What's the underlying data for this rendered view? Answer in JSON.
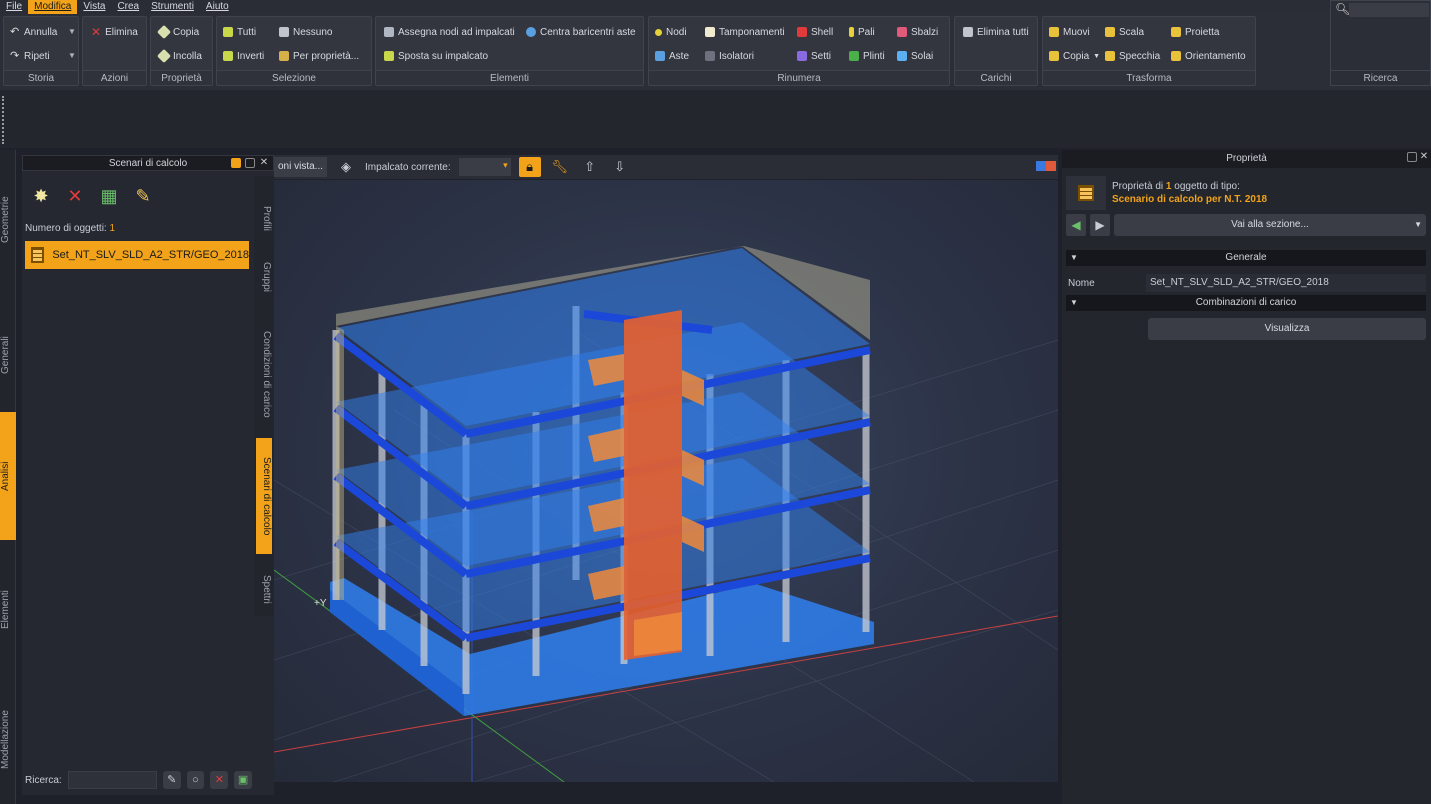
{
  "menu": [
    "File",
    "Modifica",
    "Vista",
    "Crea",
    "Strumenti",
    "Aiuto"
  ],
  "ribbon": {
    "storia": {
      "label": "Storia",
      "undo": "Annulla",
      "redo": "Ripeti"
    },
    "azioni": {
      "label": "Azioni",
      "elimina": "Elimina"
    },
    "proprieta": {
      "label": "Proprietà",
      "copia": "Copia",
      "incolla": "Incolla"
    },
    "selezione": {
      "label": "Selezione",
      "tutti": "Tutti",
      "nessuno": "Nessuno",
      "inverti": "Inverti",
      "per_proprieta": "Per proprietà..."
    },
    "elementi": {
      "label": "Elementi",
      "assegna": "Assegna nodi ad impalcati",
      "centra": "Centra baricentri aste",
      "sposta": "Sposta su impalcato"
    },
    "rinumera": {
      "label": "Rinumera",
      "nodi": "Nodi",
      "tamponamenti": "Tamponamenti",
      "shell": "Shell",
      "pali": "Pali",
      "sbalzi": "Sbalzi",
      "aste": "Aste",
      "isolatori": "Isolatori",
      "setti": "Setti",
      "plinti": "Plinti",
      "solai": "Solai"
    },
    "carichi": {
      "label": "Carichi",
      "elimina_tutti": "Elimina tutti"
    },
    "trasforma": {
      "label": "Trasforma",
      "muovi": "Muovi",
      "scala": "Scala",
      "proietta": "Proietta",
      "copia": "Copia",
      "specchia": "Specchia",
      "orientamento": "Orientamento"
    },
    "ricerca": {
      "label": "Ricerca"
    }
  },
  "left_tabs": [
    "Geometrie",
    "Generali",
    "Analisi",
    "Elementi",
    "Modellazione"
  ],
  "left_panel": {
    "title": "Scenari di calcolo",
    "count_label": "Numero di oggetti:",
    "count_value": "1",
    "item": "Set_NT_SLV_SLD_A2_STR/GEO_2018",
    "search_label": "Ricerca:"
  },
  "mid_tabs": [
    "Profili",
    "Gruppi",
    "Condizioni di carico",
    "Scenari di calcolo",
    "Spettri"
  ],
  "viewport_toolbar": {
    "view_btn": "oni vista...",
    "impalcato_label": "Impalcato corrente:"
  },
  "axis_label": "+Y",
  "right_panel": {
    "title": "Proprietà",
    "head_line1_pre": "Proprietà di",
    "head_count": "1",
    "head_line1_post": "oggetto di tipo:",
    "head_type": "Scenario di calcolo per N.T. 2018",
    "goto": "Vai alla sezione...",
    "section_general": "Generale",
    "name_key": "Nome",
    "name_value": "Set_NT_SLV_SLD_A2_STR/GEO_2018",
    "section_comb": "Combinazioni di carico",
    "show_btn": "Visualizza"
  },
  "colors": {
    "accent": "#f2a31a",
    "slab": "#2f6fe8",
    "core": "#e8602c"
  }
}
